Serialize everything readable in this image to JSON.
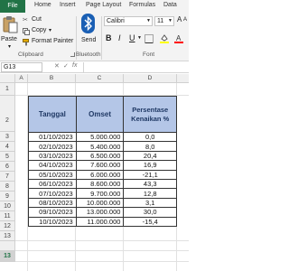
{
  "ribbon": {
    "tabs": [
      "File",
      "Home",
      "Insert",
      "Page Layout",
      "Formulas",
      "Data"
    ],
    "clipboard": {
      "paste_label": "Paste",
      "cut_label": "Cut",
      "copy_label": "Copy",
      "copy_arrow": "▾",
      "format_painter_label": "Format Painter",
      "group_label": "Clipboard"
    },
    "bluetooth": {
      "send_label": "Send",
      "group_label": "Bluetooth"
    },
    "font": {
      "font_name": "Calibri",
      "font_size": "11",
      "bold": "B",
      "italic": "I",
      "underline": "U",
      "group_label": "Font",
      "grow_font": "A",
      "shrink_font": "A"
    }
  },
  "formula_bar": {
    "name_box": "G13",
    "cancel": "✕",
    "enter": "✓",
    "fx": "fx"
  },
  "columns": [
    "A",
    "B",
    "C",
    "D"
  ],
  "rows": [
    "1",
    "2",
    "3",
    "4",
    "5",
    "6",
    "7",
    "8",
    "9",
    "10",
    "11",
    "12",
    "13"
  ],
  "selected_row": "13",
  "table": {
    "headers": [
      "Tanggal",
      "Omset",
      "Persentase Kenaikan %"
    ],
    "rows": [
      [
        "01/10/2023",
        "5.000.000",
        "0,0"
      ],
      [
        "02/10/2023",
        "5.400.000",
        "8,0"
      ],
      [
        "03/10/2023",
        "6.500.000",
        "20,4"
      ],
      [
        "04/10/2023",
        "7.600.000",
        "16,9"
      ],
      [
        "05/10/2023",
        "6.000.000",
        "-21,1"
      ],
      [
        "06/10/2023",
        "8.600.000",
        "43,3"
      ],
      [
        "07/10/2023",
        "9.700.000",
        "12,8"
      ],
      [
        "08/10/2023",
        "10.000.000",
        "3,1"
      ],
      [
        "09/10/2023",
        "13.000.000",
        "30,0"
      ],
      [
        "10/10/2023",
        "11.000.000",
        "-15,4"
      ]
    ]
  },
  "colors": {
    "accent": "#217346",
    "header_fill": "#b4c6e7",
    "header_text": "#1f3864"
  }
}
